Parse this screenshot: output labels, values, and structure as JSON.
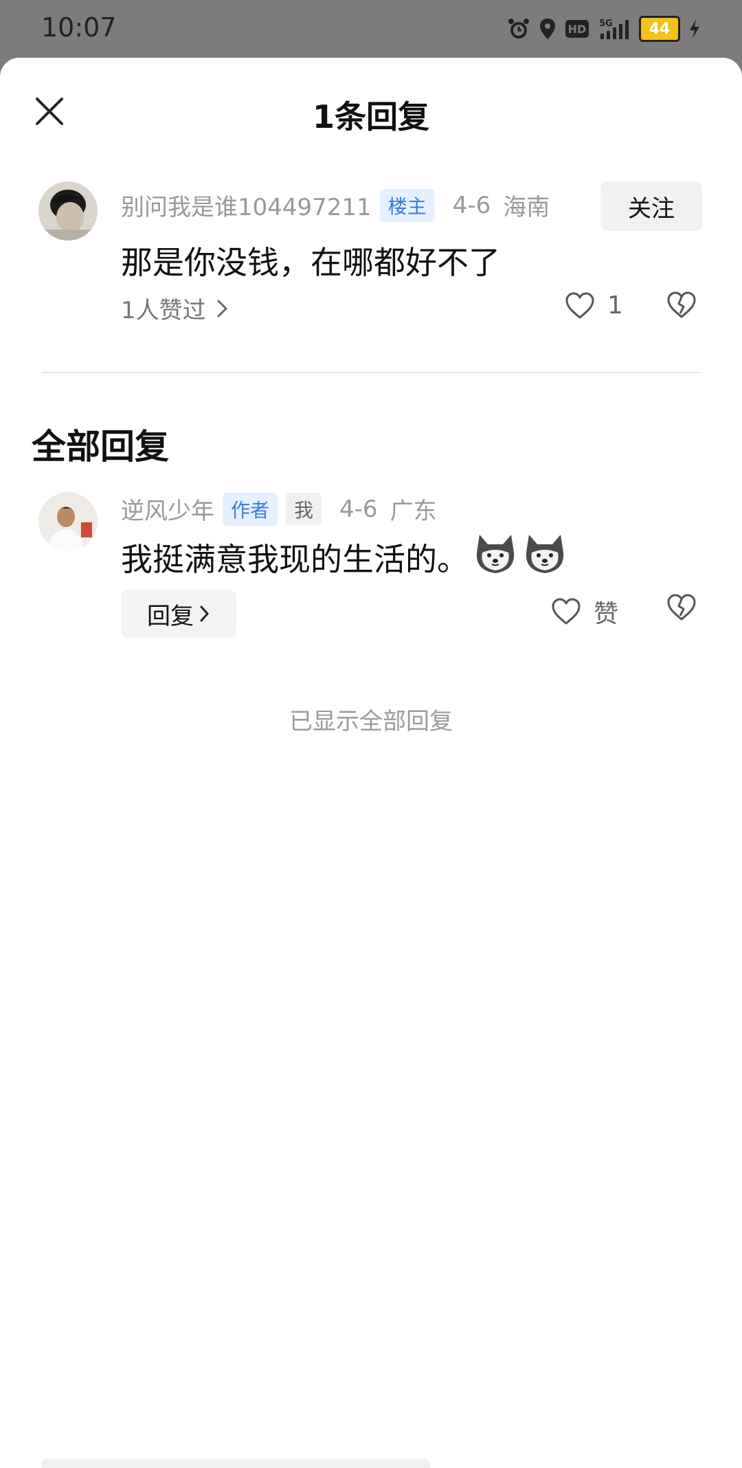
{
  "status_bar": {
    "time": "10:07",
    "battery": "44",
    "network": "5G",
    "hd_label": "HD"
  },
  "sheet": {
    "title": "1条回复"
  },
  "main_comment": {
    "username": "别问我是谁104497211",
    "tag": "楼主",
    "date": "4-6",
    "location": "海南",
    "follow_label": "关注",
    "text": "那是你没钱，在哪都好不了",
    "liked_by": "1人赞过",
    "like_count": "1"
  },
  "replies_section": {
    "title": "全部回复"
  },
  "reply": {
    "username": "逆风少年",
    "tag_author": "作者",
    "tag_me": "我",
    "date": "4-6",
    "location": "广东",
    "text": "我挺满意我现的生活的。",
    "reply_button": "回复",
    "like_label": "赞"
  },
  "end_note": "已显示全部回复",
  "colors": {
    "tag_blue": "#3a7bd5",
    "tag_blue_bg": "#e6f0ff",
    "overlay": "#7c7c7c"
  }
}
